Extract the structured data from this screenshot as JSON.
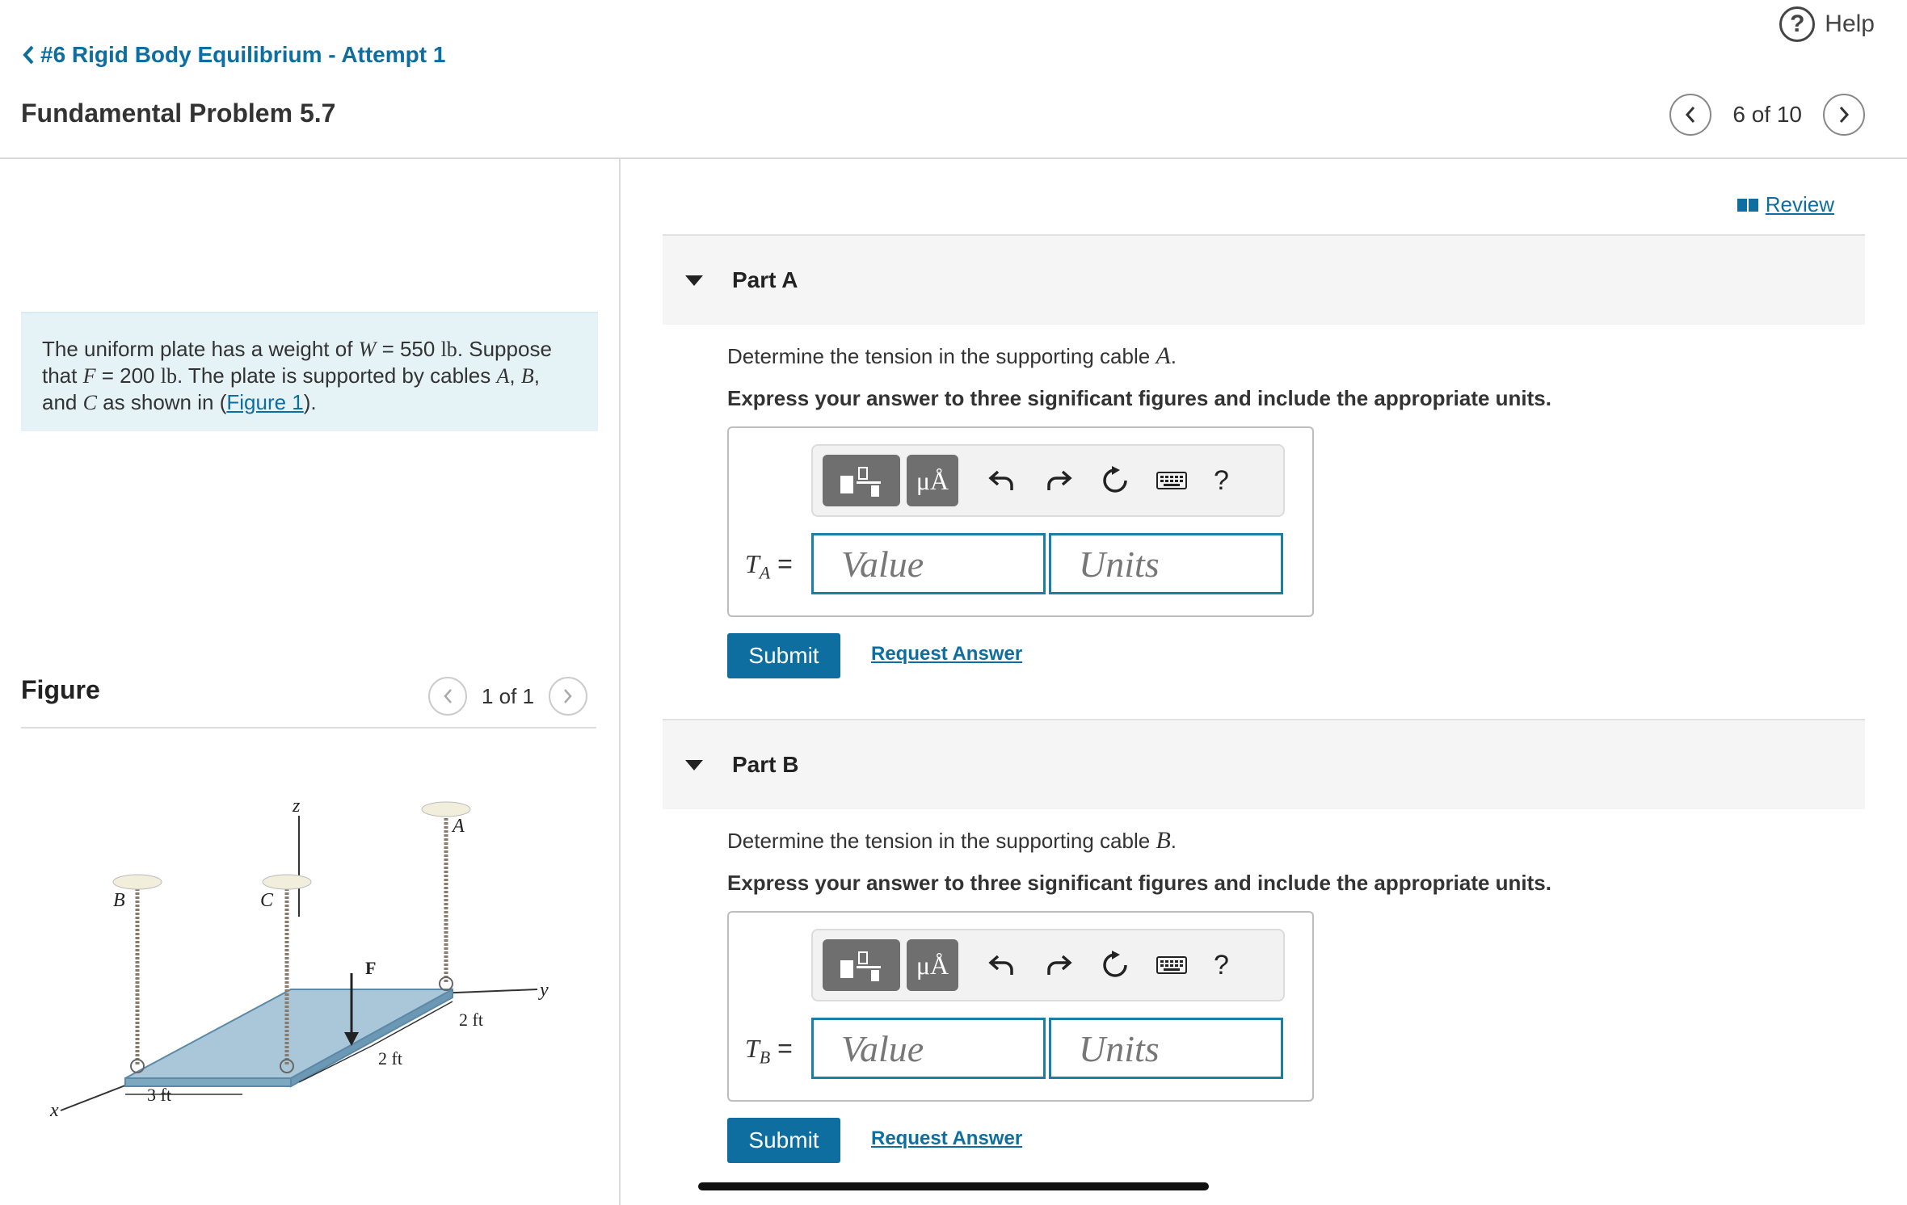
{
  "header": {
    "help_label": "Help",
    "back_label": "#6 Rigid Body Equilibrium - Attempt 1",
    "problem_title": "Fundamental Problem 5.7",
    "pager": "6 of 10"
  },
  "statement": {
    "t1": "The uniform plate has a weight of ",
    "w_sym": "W",
    "t2": " = 550 ",
    "unit1": "lb",
    "t3": ". Suppose that ",
    "f_sym": "F",
    "t4": " = 200 ",
    "unit2": "lb",
    "t5": ". The plate is supported by cables ",
    "a": "A",
    "t6": ", ",
    "b": "B",
    "t7": ", and ",
    "c": "C",
    "t8": " as shown in (",
    "figure_link": "Figure 1",
    "t9": ")."
  },
  "figure": {
    "heading": "Figure",
    "pager": "1 of 1",
    "labels": {
      "z": "z",
      "A": "A",
      "B": "B",
      "C": "C",
      "F": "F",
      "y": "y",
      "x": "x",
      "dim1": "2 ft",
      "dim2": "2 ft",
      "dim3": "3 ft"
    }
  },
  "review_label": "Review",
  "parts": [
    {
      "title": "Part A",
      "q_text": "Determine the tension in the supporting cable ",
      "q_var": "A",
      "q_end": ".",
      "instruction": "Express your answer to three significant figures and include the appropriate units.",
      "var_main": "T",
      "var_sub": "A",
      "eq": " =",
      "value_placeholder": "Value",
      "units_placeholder": "Units",
      "submit_label": "Submit",
      "request_label": "Request Answer"
    },
    {
      "title": "Part B",
      "q_text": "Determine the tension in the supporting cable ",
      "q_var": "B",
      "q_end": ".",
      "instruction": "Express your answer to three significant figures and include the appropriate units.",
      "var_main": "T",
      "var_sub": "B",
      "eq": " =",
      "value_placeholder": "Value",
      "units_placeholder": "Units",
      "submit_label": "Submit",
      "request_label": "Request Answer"
    }
  ],
  "toolbar": {
    "mu_label": "μÅ",
    "help_q": "?"
  }
}
